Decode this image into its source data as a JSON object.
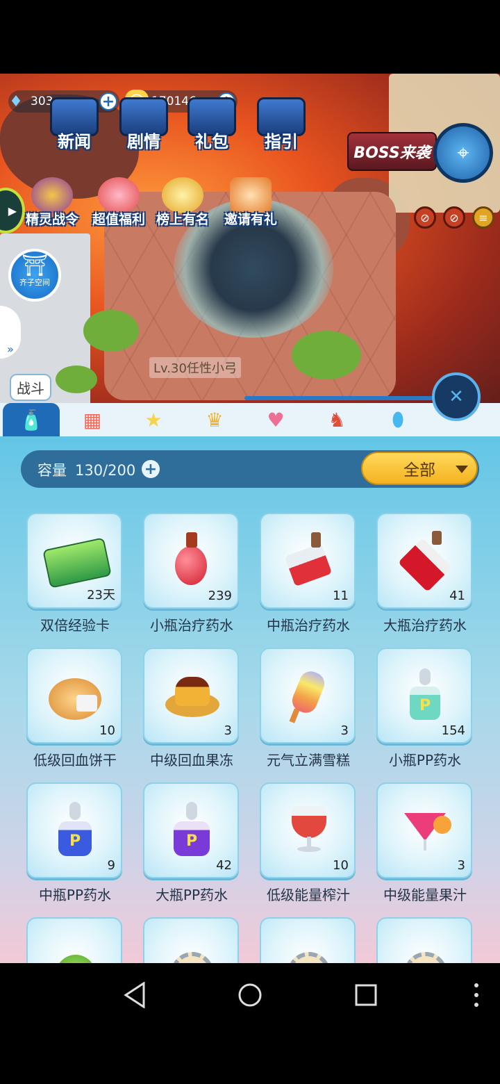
{
  "resources": {
    "gems": "303",
    "coins": "170146"
  },
  "top_menu": [
    {
      "label": "新闻",
      "icon": "newspaper-icon"
    },
    {
      "label": "剧情",
      "icon": "story-icon"
    },
    {
      "label": "礼包",
      "icon": "gift-pack-icon"
    },
    {
      "label": "指引",
      "icon": "guide-icon"
    }
  ],
  "events": [
    {
      "label": "精灵战令",
      "icon": "battle-pass-icon"
    },
    {
      "label": "超值福利",
      "icon": "welfare-gift-icon"
    },
    {
      "label": "榜上有名",
      "icon": "trophy-icon"
    },
    {
      "label": "邀请有礼",
      "icon": "invite-icon"
    }
  ],
  "boss_banner": "BOSS来袭",
  "space_button": "齐子空间",
  "pet_name": "Lv.30任性小弓",
  "battle_label": "战斗",
  "tabs": [
    {
      "icon": "potion-jar-icon",
      "active": true
    },
    {
      "icon": "blocks-icon",
      "active": false
    },
    {
      "icon": "star-wand-icon",
      "active": false
    },
    {
      "icon": "crown-badge-icon",
      "active": false
    },
    {
      "icon": "dress-icon",
      "active": false
    },
    {
      "icon": "rocking-horse-icon",
      "active": false
    },
    {
      "icon": "egg-icon",
      "active": false
    }
  ],
  "bag": {
    "capacity_label": "容量",
    "capacity_value": "130/200",
    "filter": "全部"
  },
  "items": [
    {
      "name": "双倍经验卡",
      "count": "23天",
      "icon": "exp-card-icon"
    },
    {
      "name": "小瓶治疗药水",
      "count": "239",
      "icon": "small-heal-potion-icon"
    },
    {
      "name": "中瓶治疗药水",
      "count": "11",
      "icon": "medium-heal-potion-icon"
    },
    {
      "name": "大瓶治疗药水",
      "count": "41",
      "icon": "large-heal-potion-icon"
    },
    {
      "name": "低级回血饼干",
      "count": "10",
      "icon": "biscuit-icon"
    },
    {
      "name": "中级回血果冻",
      "count": "3",
      "icon": "pudding-icon"
    },
    {
      "name": "元气立满雪糕",
      "count": "3",
      "icon": "popsicle-icon"
    },
    {
      "name": "小瓶PP药水",
      "count": "154",
      "icon": "small-pp-potion-icon"
    },
    {
      "name": "中瓶PP药水",
      "count": "9",
      "icon": "medium-pp-potion-icon"
    },
    {
      "name": "大瓶PP药水",
      "count": "42",
      "icon": "large-pp-potion-icon"
    },
    {
      "name": "低级能量榨汁",
      "count": "10",
      "icon": "juice-glass-icon"
    },
    {
      "name": "中级能量果汁",
      "count": "3",
      "icon": "cocktail-icon"
    },
    {
      "name": "",
      "count": "",
      "icon": "green-fruit-icon"
    },
    {
      "name": "",
      "count": "",
      "icon": "gear-item-icon"
    },
    {
      "name": "",
      "count": "",
      "icon": "gear-item-icon"
    },
    {
      "name": "",
      "count": "",
      "icon": "gear-item-icon"
    }
  ]
}
